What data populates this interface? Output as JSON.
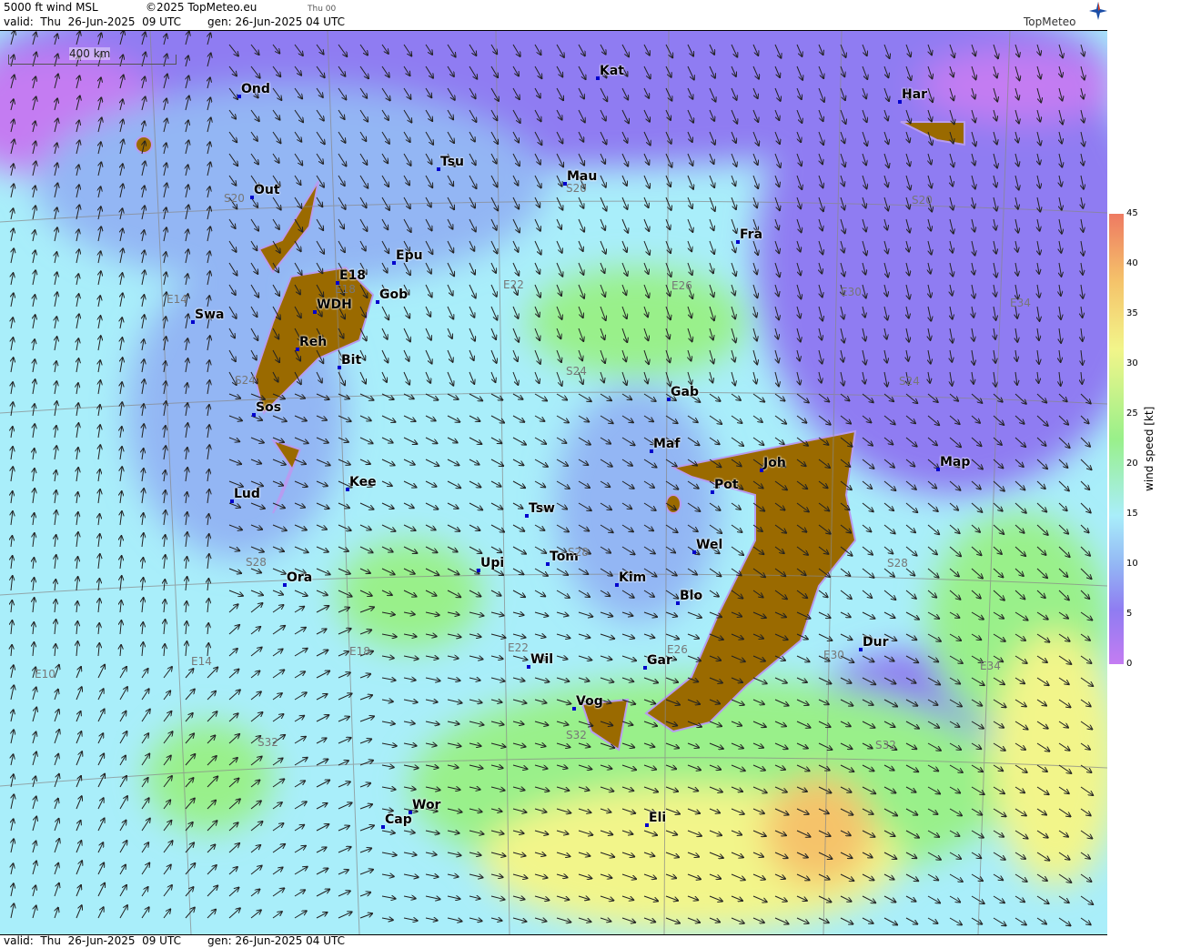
{
  "header": {
    "title": "5000 ft wind MSL",
    "copyright": "©2025 TopMeteo.eu",
    "run_tag": "Thu 00",
    "valid": "valid:  Thu  26-Jun-2025  09 UTC",
    "gen": "gen: 26-Jun-2025 04 UTC"
  },
  "footer": {
    "valid": "valid:  Thu  26-Jun-2025  09 UTC",
    "gen": "gen: 26-Jun-2025 04 UTC"
  },
  "logo": {
    "text": "TopMeteo",
    "icon": "compass-star-icon"
  },
  "scale": {
    "label": "400 km"
  },
  "legend": {
    "title": "wind speed  [kt]",
    "ticks": [
      "45",
      "40",
      "35",
      "30",
      "25",
      "20",
      "15",
      "10",
      "5",
      "0"
    ],
    "colors": [
      "#c47cf2",
      "#8f7cf2",
      "#93b6f4",
      "#a9eefa",
      "#99f08a",
      "#f2f58a",
      "#f5c36a",
      "#ee7a62"
    ]
  },
  "cities": [
    "Ond",
    "Kat",
    "Har",
    "Tsu",
    "Mau",
    "Out",
    "Fra",
    "Epu",
    "E18",
    "WDH",
    "Gob",
    "Swa",
    "Reh",
    "Bit",
    "Gab",
    "Sos",
    "Maf",
    "Joh",
    "Map",
    "Pot",
    "Kee",
    "Lud",
    "Tsw",
    "Wel",
    "Upi",
    "Tom",
    "Kim",
    "Ora",
    "Blo",
    "Wil",
    "Gar",
    "Dur",
    "Vog",
    "Wor",
    "Cap",
    "Eli"
  ],
  "coords": [
    "S20",
    "S20",
    "S20",
    "E14",
    "E18",
    "E22",
    "E26",
    "E30",
    "E34",
    "S24",
    "S24",
    "S24",
    "S28",
    "S28",
    "S28",
    "E14",
    "E10",
    "E18",
    "E22",
    "E26",
    "E30",
    "E34",
    "S32",
    "S32",
    "S32"
  ],
  "colors": {
    "calm": "#c47cf2",
    "light": "#8f7cf2",
    "moderate": "#93b6f4",
    "fresh": "#a9eefa",
    "strong": "#99f08a",
    "terrain": "#9a6a00",
    "station": "#0000cc"
  }
}
